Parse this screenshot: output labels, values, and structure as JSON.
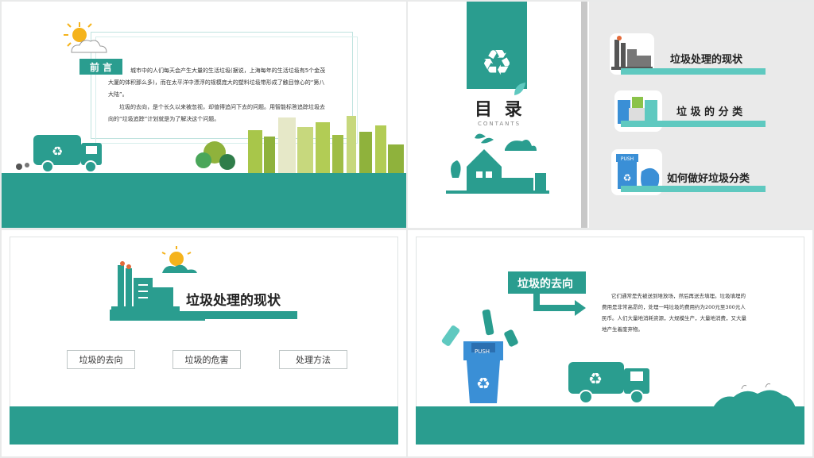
{
  "colors": {
    "teal": "#2a9d8f",
    "lightTeal": "#5fc9c0",
    "yellow": "#f5b31c",
    "blue": "#3a8fd6",
    "grey": "#6d6d6d"
  },
  "slide1": {
    "badge": "前 言",
    "para1": "城市中的人们每天会产生大量的生活垃圾(据说，上海每年的生活垃圾有5个金茂大厦的体积那么多)，而在太平洋中漂浮的规模庞大的塑料垃圾带形成了触目惊心的“第八大陆”。",
    "para2": "垃圾的去向，是个长久以来被忽视，却值得追问下去的问题。用智能标答追踪垃圾去向的“垃圾追踪”计划就是为了解决这个问题。"
  },
  "slide2": {
    "title": "目 录",
    "subtitle": "CONTANTS",
    "items": [
      {
        "label": "垃圾处理的现状",
        "icon": "factory-icon"
      },
      {
        "label": "垃 圾 的 分 类",
        "icon": "bins-icon"
      },
      {
        "label": "如何做好垃圾分类",
        "icon": "push-bin-icon"
      }
    ]
  },
  "slide3": {
    "title": "垃圾处理的现状",
    "buttons": [
      "垃圾的去向",
      "垃圾的危害",
      "处理方法"
    ]
  },
  "slide4": {
    "title": "垃圾的去向",
    "bin_label": "PUSH",
    "para": "它们通常是先被送到堆放场，然后再送去填埋。垃圾填埋的费用是非常高昂的，处理一吨垃圾的费用约为200元至300元人民币。人们大量地消耗资源，大规模生产，大量地消费，又大量地产生着废弃物。"
  }
}
